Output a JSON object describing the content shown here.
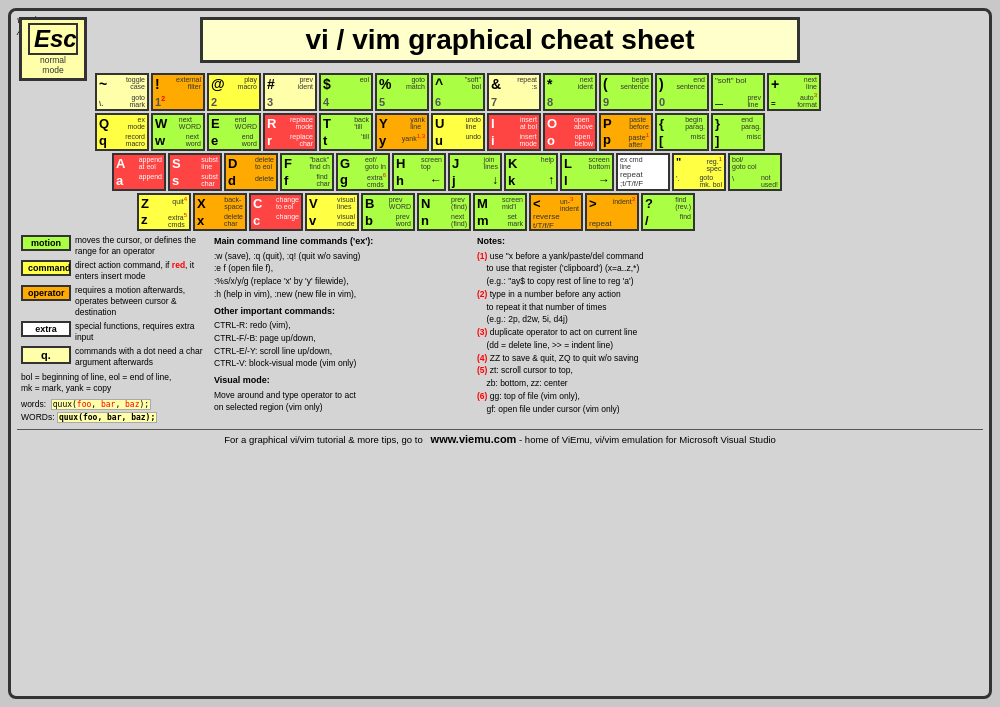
{
  "version": "version 1.1\nApril 1st, 06",
  "title": "vi / vim graphical cheat sheet",
  "esc": {
    "key": "Esc",
    "label": "normal\nmode"
  },
  "footer": {
    "text": "For a graphical vi/vim tutorial & more tips, go to",
    "url": "www.viemu.com",
    "suffix": " - home of ViEmu, vi/vim emulation for Microsoft Visual Studio"
  },
  "legend": {
    "motion": {
      "badge": "motion",
      "desc": "moves the cursor, or defines the range for an operator"
    },
    "command": {
      "badge": "command",
      "desc": "direct action command, if red, it enters insert mode"
    },
    "operator": {
      "badge": "operator",
      "desc": "requires a motion afterwards, operates between cursor & destination"
    },
    "extra": {
      "badge": "extra",
      "desc": "special functions, requires extra input"
    },
    "dot": {
      "symbol": "q.",
      "desc": "commands with a dot need a char argument afterwards"
    },
    "bol": "bol = beginning of line, eol = end of line,\nmk = mark, yank = copy",
    "words": "words:  quux(foo, bar, baz);",
    "WORDs": "WORDs: quux(foo, bar, baz);"
  },
  "main_commands": {
    "title": "Main command line commands ('ex'):",
    "lines": [
      ":w (save), :q (quit), :q! (quit w/o saving)",
      ":e f (open file f),",
      ":%s/x/y/g (replace 'x' by 'y' filewide),",
      ":h (help in vim), :new (new file in vim),"
    ]
  },
  "other_commands": {
    "title": "Other important commands:",
    "lines": [
      "CTRL-R: redo (vim),",
      "CTRL-F/-B: page up/down,",
      "CTRL-E/-Y: scroll line up/down,",
      "CTRL-V: block-visual mode (vim only)"
    ]
  },
  "visual_mode": {
    "title": "Visual mode:",
    "lines": [
      "Move around and type operator to act",
      "on selected region (vim only)"
    ]
  },
  "notes": {
    "title": "Notes:",
    "items": [
      "(1) use \"x before a yank/paste/del command\n    to use that register ('clipboard') (x=a..z,*)\n    (e.g.: \"ay$ to copy rest of line to reg 'a')",
      "(2) type in a number before any action\n    to repeat it that number of times\n    (e.g.: 2p, d2w, 5i, d4j)",
      "(3) duplicate operator to act on current line\n    (dd = delete line, >> = indent line)",
      "(4) ZZ to save & quit, ZQ to quit w/o saving",
      "(5) zt: scroll cursor to top,\n    zb: bottom, zz: center",
      "(6) gg: top of file (vim only),\n    gf: open file under cursor (vim only)"
    ]
  }
}
